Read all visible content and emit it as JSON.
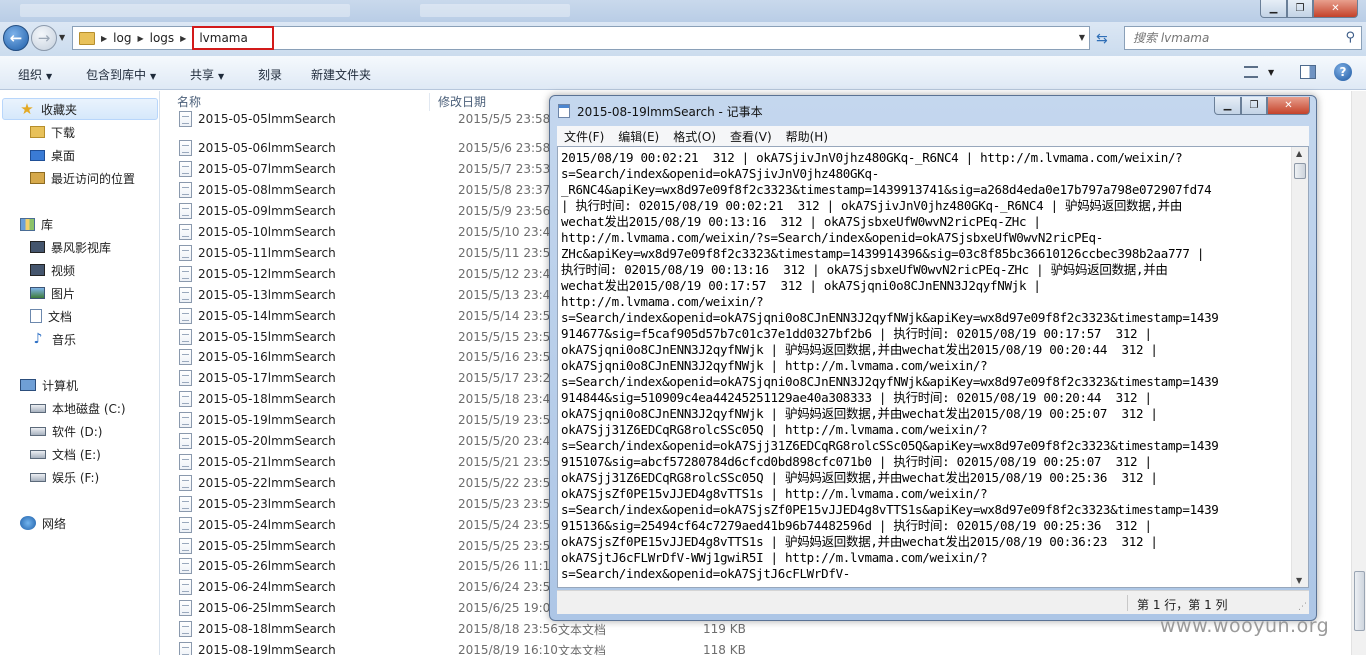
{
  "explorer": {
    "address": {
      "segments": [
        "log",
        "logs",
        "lvmama"
      ]
    },
    "search_placeholder": "搜索 lvmama",
    "toolbar": [
      {
        "label": "组织",
        "dropdown": true
      },
      {
        "label": "包含到库中",
        "dropdown": true
      },
      {
        "label": "共享",
        "dropdown": true
      },
      {
        "label": "刻录",
        "dropdown": false
      },
      {
        "label": "新建文件夹",
        "dropdown": false
      }
    ],
    "nav": {
      "favorites": {
        "label": "收藏夹",
        "items": [
          "下载",
          "桌面",
          "最近访问的位置"
        ]
      },
      "libraries": {
        "label": "库",
        "items": [
          "暴风影视库",
          "视频",
          "图片",
          "文档",
          "音乐"
        ]
      },
      "computer": {
        "label": "计算机",
        "items": [
          "本地磁盘 (C:)",
          "软件 (D:)",
          "文档 (E:)",
          "娱乐 (F:)"
        ]
      },
      "network": {
        "label": "网络"
      }
    },
    "columns": {
      "name": "名称",
      "date": "修改日期"
    },
    "files": [
      {
        "name": "2015-05-05lmmSearch",
        "date": "2015/5/5 23:58",
        "type": "",
        "size": ""
      },
      {
        "name": "2015-05-06lmmSearch",
        "date": "2015/5/6 23:58",
        "type": "",
        "size": ""
      },
      {
        "name": "2015-05-07lmmSearch",
        "date": "2015/5/7 23:53",
        "type": "",
        "size": ""
      },
      {
        "name": "2015-05-08lmmSearch",
        "date": "2015/5/8 23:37",
        "type": "",
        "size": ""
      },
      {
        "name": "2015-05-09lmmSearch",
        "date": "2015/5/9 23:56",
        "type": "",
        "size": ""
      },
      {
        "name": "2015-05-10lmmSearch",
        "date": "2015/5/10 23:46",
        "type": "",
        "size": ""
      },
      {
        "name": "2015-05-11lmmSearch",
        "date": "2015/5/11 23:50",
        "type": "",
        "size": ""
      },
      {
        "name": "2015-05-12lmmSearch",
        "date": "2015/5/12 23:40",
        "type": "",
        "size": ""
      },
      {
        "name": "2015-05-13lmmSearch",
        "date": "2015/5/13 23:48",
        "type": "",
        "size": ""
      },
      {
        "name": "2015-05-14lmmSearch",
        "date": "2015/5/14 23:55",
        "type": "",
        "size": ""
      },
      {
        "name": "2015-05-15lmmSearch",
        "date": "2015/5/15 23:59",
        "type": "",
        "size": ""
      },
      {
        "name": "2015-05-16lmmSearch",
        "date": "2015/5/16 23:50",
        "type": "",
        "size": ""
      },
      {
        "name": "2015-05-17lmmSearch",
        "date": "2015/5/17 23:28",
        "type": "",
        "size": ""
      },
      {
        "name": "2015-05-18lmmSearch",
        "date": "2015/5/18 23:49",
        "type": "",
        "size": ""
      },
      {
        "name": "2015-05-19lmmSearch",
        "date": "2015/5/19 23:58",
        "type": "",
        "size": ""
      },
      {
        "name": "2015-05-20lmmSearch",
        "date": "2015/5/20 23:46",
        "type": "",
        "size": ""
      },
      {
        "name": "2015-05-21lmmSearch",
        "date": "2015/5/21 23:59",
        "type": "",
        "size": ""
      },
      {
        "name": "2015-05-22lmmSearch",
        "date": "2015/5/22 23:57",
        "type": "",
        "size": ""
      },
      {
        "name": "2015-05-23lmmSearch",
        "date": "2015/5/23 23:57",
        "type": "",
        "size": ""
      },
      {
        "name": "2015-05-24lmmSearch",
        "date": "2015/5/24 23:59",
        "type": "",
        "size": ""
      },
      {
        "name": "2015-05-25lmmSearch",
        "date": "2015/5/25 23:58",
        "type": "",
        "size": ""
      },
      {
        "name": "2015-05-26lmmSearch",
        "date": "2015/5/26 11:12",
        "type": "",
        "size": ""
      },
      {
        "name": "2015-06-24lmmSearch",
        "date": "2015/6/24 23:58",
        "type": "",
        "size": ""
      },
      {
        "name": "2015-06-25lmmSearch",
        "date": "2015/6/25 19:04",
        "type": "",
        "size": ""
      },
      {
        "name": "2015-08-18lmmSearch",
        "date": "2015/8/18 23:56",
        "type": "文本文档",
        "size": "119 KB"
      },
      {
        "name": "2015-08-19lmmSearch",
        "date": "2015/8/19 16:10",
        "type": "文本文档",
        "size": "118 KB"
      }
    ]
  },
  "notepad": {
    "title": "2015-08-19lmmSearch - 记事本",
    "menus": [
      "文件(F)",
      "编辑(E)",
      "格式(O)",
      "查看(V)",
      "帮助(H)"
    ],
    "content_lines": [
      "2015/08/19 00:02:21  312 | okA7SjivJnV0jhz480GKq-_R6NC4 | http://m.lvmama.com/weixin/?",
      "s=Search/index&openid=okA7SjivJnV0jhz480GKq-",
      "_R6NC4&apiKey=wx8d97e09f8f2c3323&timestamp=1439913741&sig=a268d4eda0e17b797a798e072907fd74",
      "| 执行时间: 02015/08/19 00:02:21  312 | okA7SjivJnV0jhz480GKq-_R6NC4 | 驴妈妈返回数据,并由",
      "wechat发出2015/08/19 00:13:16  312 | okA7SjsbxeUfW0wvN2ricPEq-ZHc |",
      "http://m.lvmama.com/weixin/?s=Search/index&openid=okA7SjsbxeUfW0wvN2ricPEq-",
      "ZHc&apiKey=wx8d97e09f8f2c3323&timestamp=1439914396&sig=03c8f85bc36610126ccbec398b2aa777 |",
      "执行时间: 02015/08/19 00:13:16  312 | okA7SjsbxeUfW0wvN2ricPEq-ZHc | 驴妈妈返回数据,并由",
      "wechat发出2015/08/19 00:17:57  312 | okA7Sjqni0o8CJnENN3J2qyfNWjk |",
      "http://m.lvmama.com/weixin/?",
      "s=Search/index&openid=okA7Sjqni0o8CJnENN3J2qyfNWjk&apiKey=wx8d97e09f8f2c3323&timestamp=1439",
      "914677&sig=f5caf905d57b7c01c37e1dd0327bf2b6 | 执行时间: 02015/08/19 00:17:57  312 |",
      "okA7Sjqni0o8CJnENN3J2qyfNWjk | 驴妈妈返回数据,并由wechat发出2015/08/19 00:20:44  312 |",
      "okA7Sjqni0o8CJnENN3J2qyfNWjk | http://m.lvmama.com/weixin/?",
      "s=Search/index&openid=okA7Sjqni0o8CJnENN3J2qyfNWjk&apiKey=wx8d97e09f8f2c3323&timestamp=1439",
      "914844&sig=510909c4ea44245251129ae40a308333 | 执行时间: 02015/08/19 00:20:44  312 |",
      "okA7Sjqni0o8CJnENN3J2qyfNWjk | 驴妈妈返回数据,并由wechat发出2015/08/19 00:25:07  312 |",
      "okA7Sjj31Z6EDCqRG8rolcSSc05Q | http://m.lvmama.com/weixin/?",
      "s=Search/index&openid=okA7Sjj31Z6EDCqRG8rolcSSc05Q&apiKey=wx8d97e09f8f2c3323&timestamp=1439",
      "915107&sig=abcf57280784d6cfcd0bd898cfc071b0 | 执行时间: 02015/08/19 00:25:07  312 |",
      "okA7Sjj31Z6EDCqRG8rolcSSc05Q | 驴妈妈返回数据,并由wechat发出2015/08/19 00:25:36  312 |",
      "okA7SjsZf0PE15vJJED4g8vTTS1s | http://m.lvmama.com/weixin/?",
      "s=Search/index&openid=okA7SjsZf0PE15vJJED4g8vTTS1s&apiKey=wx8d97e09f8f2c3323&timestamp=1439",
      "915136&sig=25494cf64c7279aed41b96b74482596d | 执行时间: 02015/08/19 00:25:36  312 |",
      "okA7SjsZf0PE15vJJED4g8vTTS1s | 驴妈妈返回数据,并由wechat发出2015/08/19 00:36:23  312 |",
      "okA7SjtJ6cFLWrDfV-WWj1gwiR5I | http://m.lvmama.com/weixin/?",
      "s=Search/index&openid=okA7SjtJ6cFLWrDfV-"
    ],
    "status_position": "第 1 行，第 1 列"
  },
  "watermark": "www.wooyun.org"
}
